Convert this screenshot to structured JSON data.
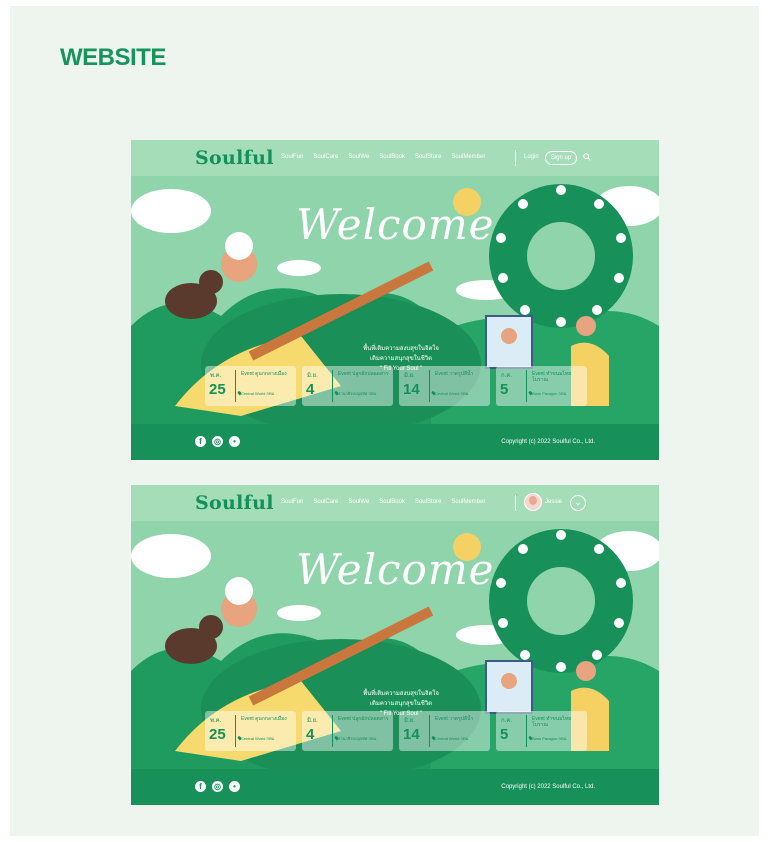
{
  "page": {
    "title": "WEBSITE"
  },
  "nav": {
    "logo": "Soulful",
    "items": [
      "SoulFun",
      "SoulCare",
      "SoulWe",
      "SoulBook",
      "SoulStore",
      "SoulMember"
    ],
    "login": "Login",
    "signup": "Sign up",
    "username": "Jessie"
  },
  "hero": {
    "welcome": "Welcome",
    "tagline_line1": "พื้นที่เติมความสงบสุขในจิตใจ",
    "tagline_line2": "เติมความสนุกสุขในชีวิต",
    "tagline_line3": "\" Fill Your Soul \""
  },
  "events_a": [
    {
      "month": "พ.ค.",
      "day": "25",
      "title": "Event ดูนกกลางเมือง",
      "location": "Central World กทม."
    },
    {
      "month": "มิ.ย.",
      "day": "4",
      "title": "Event ปลูกผักปลอดสาร",
      "location": "สวนวชิรเบญจทัศ กทม."
    },
    {
      "month": "มิ.ย.",
      "day": "14",
      "title": "Event วาดรูปสีน้ำ",
      "location": "Central World กทม."
    },
    {
      "month": "ก.ค.",
      "day": "5",
      "title": "Event ทำขนมไทยโบราณ",
      "location": "Siam Paragon กทม."
    }
  ],
  "events_b": [
    {
      "month": "พ.ค.",
      "day": "25",
      "title": "Event ดูนกกลางเมือง",
      "location": "Central World กทม."
    },
    {
      "month": "มิ.ย.",
      "day": "4",
      "title": "Event ปลูกผักปลอดสาร",
      "location": "สวนวชิรเบญจทัศ กทม."
    },
    {
      "month": "มิ.ย.",
      "day": "14",
      "title": "Event วาดรูปสีน้ำ",
      "location": "Central World กทม."
    },
    {
      "month": "ก.ค.",
      "day": "5",
      "title": "Event ทำขนมไทยโบราณ",
      "location": "Siam Paragon กทม."
    }
  ],
  "footer": {
    "copyright": "Copyright (c) 2022 Soulful Co., Ltd.",
    "social_icons": [
      "facebook-icon",
      "instagram-icon",
      "line-icon"
    ]
  },
  "colors": {
    "brand": "#179059",
    "hero_bg": "#8fd4ab",
    "board": "#eef5ef"
  }
}
